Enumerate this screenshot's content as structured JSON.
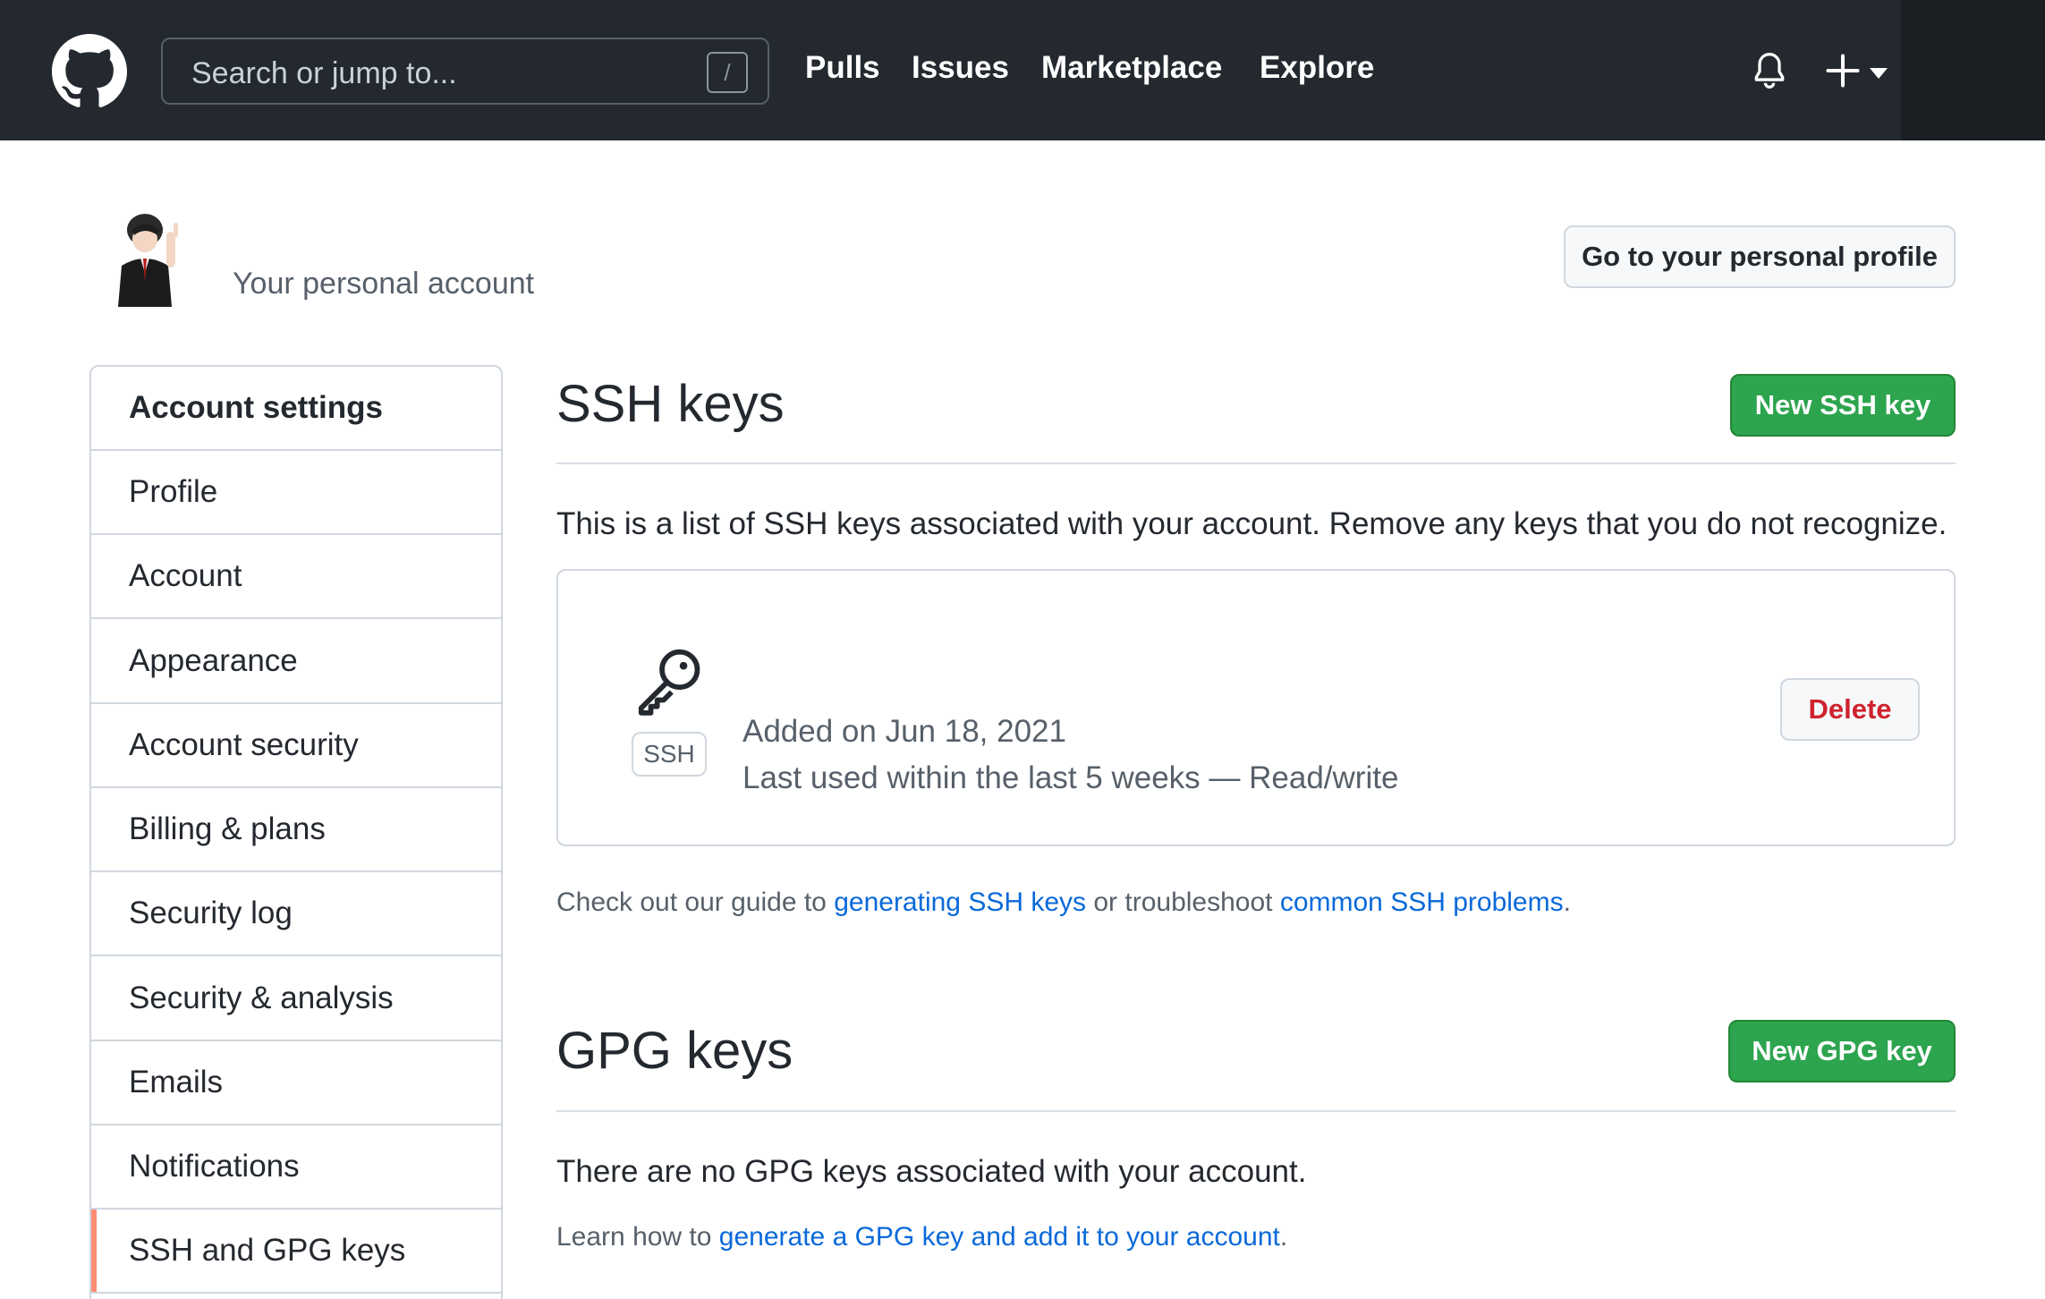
{
  "header": {
    "search_placeholder": "Search or jump to...",
    "search_shortcut": "/",
    "nav": [
      "Pulls",
      "Issues",
      "Marketplace",
      "Explore"
    ],
    "icons": [
      "github-logo-icon",
      "bell-icon",
      "plus-icon",
      "caret-down-icon"
    ]
  },
  "account": {
    "label": "Your personal account",
    "profile_button": "Go to your personal profile"
  },
  "sidebar": {
    "title": "Account settings",
    "items": [
      {
        "label": "Profile",
        "active": false
      },
      {
        "label": "Account",
        "active": false
      },
      {
        "label": "Appearance",
        "active": false
      },
      {
        "label": "Account security",
        "active": false
      },
      {
        "label": "Billing & plans",
        "active": false
      },
      {
        "label": "Security log",
        "active": false
      },
      {
        "label": "Security & analysis",
        "active": false
      },
      {
        "label": "Emails",
        "active": false
      },
      {
        "label": "Notifications",
        "active": false
      },
      {
        "label": "SSH and GPG keys",
        "active": true
      }
    ]
  },
  "ssh": {
    "title": "SSH keys",
    "new_button": "New SSH key",
    "description": "This is a list of SSH keys associated with your account. Remove any keys that you do not recognize.",
    "key": {
      "type_label": "SSH",
      "added": "Added on Jun 18, 2021",
      "last_used": "Last used within the last 5 weeks — Read/write",
      "delete_label": "Delete"
    },
    "guide": {
      "prefix": "Check out our guide to ",
      "link1": "generating SSH keys",
      "middle": " or troubleshoot ",
      "link2": "common SSH problems",
      "suffix": "."
    }
  },
  "gpg": {
    "title": "GPG keys",
    "new_button": "New GPG key",
    "empty_text": "There are no GPG keys associated with your account.",
    "learn": {
      "prefix": "Learn how to ",
      "link": "generate a GPG key and add it to your account",
      "suffix": "."
    }
  },
  "colors": {
    "header_bg": "#24292f",
    "green": "#2da44e",
    "link": "#0969da",
    "danger": "#cf222e",
    "active_marker": "#fd8c73"
  }
}
